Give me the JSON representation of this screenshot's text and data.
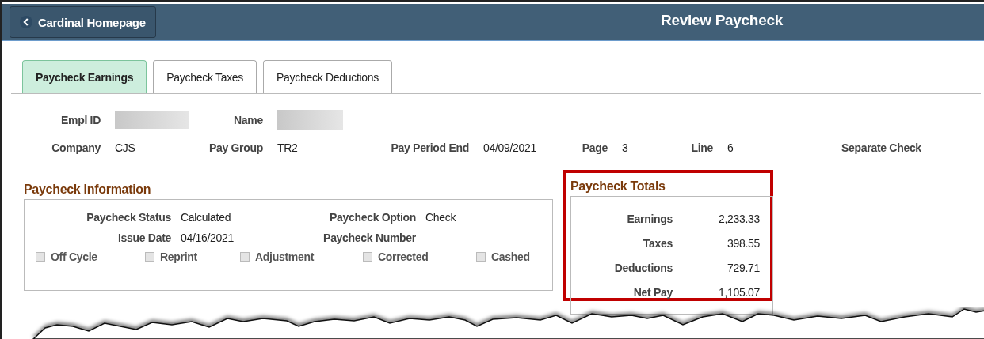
{
  "header": {
    "back_button": "Cardinal Homepage",
    "title": "Review Paycheck"
  },
  "tabs": [
    {
      "label": "Paycheck Earnings",
      "selected": true
    },
    {
      "label": "Paycheck Taxes",
      "selected": false
    },
    {
      "label": "Paycheck Deductions",
      "selected": false
    }
  ],
  "employee": [
    {
      "label": "Empl ID",
      "redacted": true
    },
    {
      "label": "Name",
      "redacted": true
    }
  ],
  "details": [
    {
      "label": "Company",
      "value": "CJS"
    },
    {
      "label": "Pay Group",
      "value": "TR2"
    },
    {
      "label": "Pay Period End",
      "value": "04/09/2021"
    },
    {
      "label": "Page",
      "value": "3"
    },
    {
      "label": "Line",
      "value": "6"
    },
    {
      "label": "Separate Check"
    }
  ],
  "paycheck_information": {
    "title": "Paycheck Information",
    "fields": [
      {
        "label": "Paycheck Status",
        "value": "Calculated"
      },
      {
        "label": "Paycheck Option",
        "value": "Check"
      },
      {
        "label": "Issue Date",
        "value": "04/16/2021"
      },
      {
        "label": "Paycheck Number"
      }
    ],
    "checkboxes": [
      {
        "label": "Off Cycle",
        "checked": false,
        "disabled": true
      },
      {
        "label": "Reprint",
        "checked": false,
        "disabled": true
      },
      {
        "label": "Adjustment",
        "checked": false,
        "disabled": true
      },
      {
        "label": "Corrected",
        "checked": false,
        "disabled": true
      },
      {
        "label": "Cashed",
        "checked": false,
        "disabled": true
      }
    ]
  },
  "paycheck_totals": {
    "title": "Paycheck Totals",
    "highlighted": true,
    "rows": [
      {
        "label": "Earnings",
        "value": "2,233.33"
      },
      {
        "label": "Taxes",
        "value": "398.55"
      },
      {
        "label": "Deductions",
        "value": "729.71"
      },
      {
        "label": "Net Pay",
        "value": "1,105.07"
      }
    ]
  }
}
